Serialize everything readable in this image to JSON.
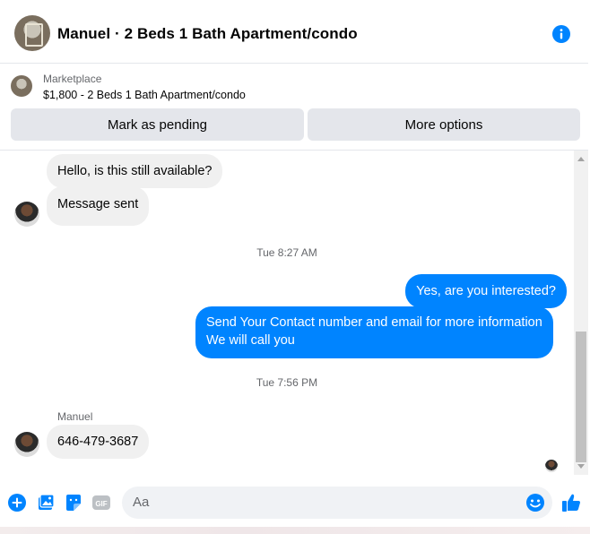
{
  "header": {
    "title": "Manuel · 2 Beds 1 Bath Apartment/condo"
  },
  "listing": {
    "source": "Marketplace",
    "product": "$1,800 - 2 Beds 1 Bath Apartment/condo",
    "buttons": {
      "pending": "Mark as pending",
      "more": "More options"
    }
  },
  "messages": [
    {
      "from": "them",
      "text": "Hello, is this still available?"
    },
    {
      "from": "them",
      "text": "Message sent"
    },
    {
      "type": "timestamp",
      "text": "Tue 8:27 AM"
    },
    {
      "from": "me",
      "text": "Yes, are you interested?"
    },
    {
      "from": "me",
      "text": "Send Your Contact number and email for more information\nWe will call you",
      "lines": [
        "Send Your Contact number and email for more information",
        "We will call you"
      ]
    },
    {
      "type": "timestamp",
      "text": "Tue 7:56 PM"
    },
    {
      "from": "them",
      "sender": "Manuel",
      "text": "646-479-3687"
    }
  ],
  "composer": {
    "placeholder": "Aa",
    "icons": [
      "plus-icon",
      "image-icon",
      "sticker-icon",
      "gif-icon",
      "emoji-icon",
      "thumbs-up-icon"
    ]
  },
  "colors": {
    "accent": "#0084ff",
    "incoming_bubble": "#f0f0f0",
    "button_bg": "#e4e6eb"
  }
}
